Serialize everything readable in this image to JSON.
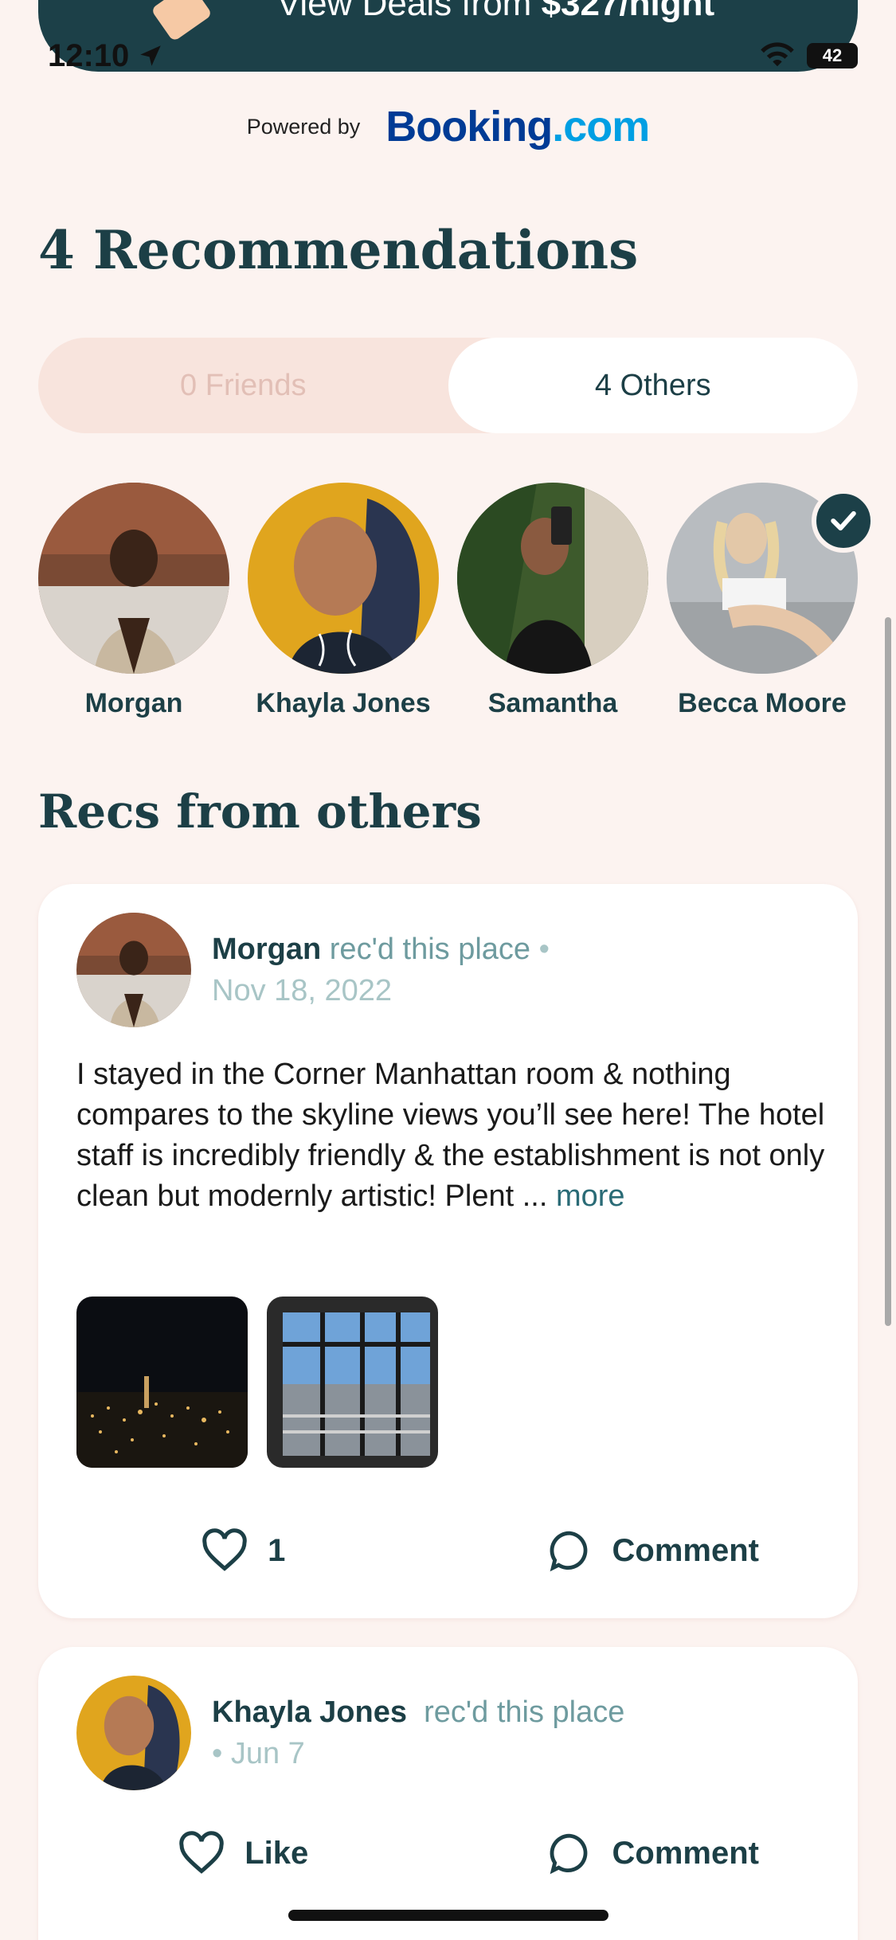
{
  "deal_bar": {
    "text": "View Deals from",
    "price": "$327/night"
  },
  "status_bar": {
    "time": "12:10",
    "battery": "42"
  },
  "powered": {
    "label": "Powered by",
    "logo_main": "Booking",
    "logo_dot": ".com"
  },
  "recommendations": {
    "title": "4 Recommendations"
  },
  "tabs": [
    {
      "label": "0 Friends",
      "selected": false
    },
    {
      "label": "4 Others",
      "selected": true
    }
  ],
  "people": [
    {
      "name": "Morgan",
      "verified": false
    },
    {
      "name": "Khayla Jones",
      "verified": false
    },
    {
      "name": "Samantha",
      "verified": false
    },
    {
      "name": "Becca Moore",
      "verified": true
    }
  ],
  "section": {
    "title": "Recs from others"
  },
  "recs": [
    {
      "author": "Morgan",
      "action": "rec'd this place",
      "separator": "•",
      "date": "Nov 18, 2022",
      "text": "I stayed in the Corner Manhattan room & nothing compares to the skyline views you’ll see here! The hotel staff is incredibly friendly & the establishment is not only clean but modernly artistic! Plent ...",
      "more": "more",
      "likes": "1",
      "comment_label": "Comment"
    },
    {
      "author": "Khayla Jones",
      "action": "rec'd this place",
      "date": "• Jun 7",
      "like_label": "Like",
      "comment_label": "Comment"
    }
  ]
}
